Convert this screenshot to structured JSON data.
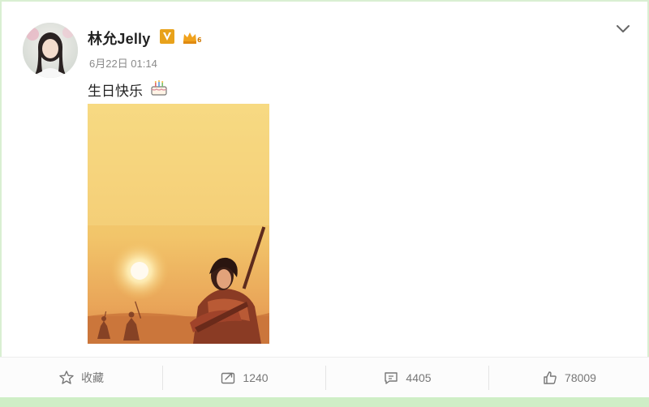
{
  "post": {
    "username": "林允Jelly",
    "timestamp": "6月22日 01:14",
    "text": "生日快乐"
  },
  "icons": {
    "verified": "verified-v-icon",
    "vip": "vip-crown-icon",
    "emoji": "birthday-cake-icon",
    "menu": "chevron-down-icon"
  },
  "actions": {
    "favorite_label": "收藏",
    "repost_count": "1240",
    "comment_count": "4405",
    "like_count": "78009"
  },
  "colors": {
    "verified_badge": "#e8a21b",
    "frame_accent": "#cfeec6"
  }
}
